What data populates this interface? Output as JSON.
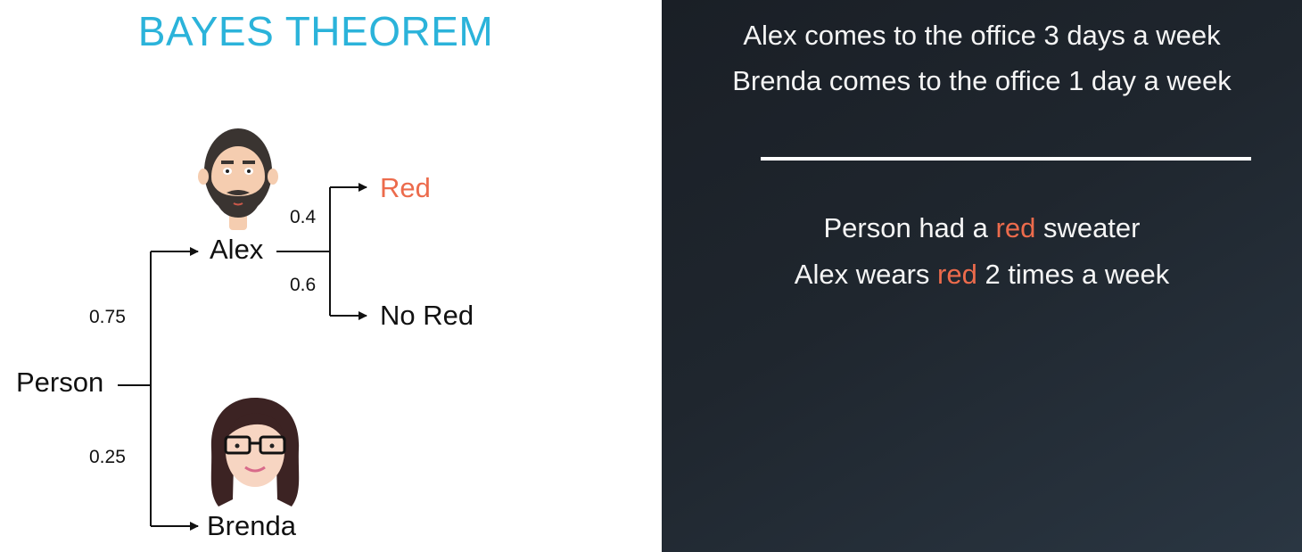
{
  "title": "BAYES THEOREM",
  "tree": {
    "root": "Person",
    "alex": "Alex",
    "brenda": "Brenda",
    "p_alex": "0.75",
    "p_brenda": "0.25",
    "red": "Red",
    "no_red": "No Red",
    "p_red": "0.4",
    "p_no_red": "0.6"
  },
  "facts": {
    "line1": "Alex comes to the office 3 days a week",
    "line2": "Brenda comes to the office 1 day a week"
  },
  "observation": {
    "line1_a": "Person had a ",
    "line1_red": "red",
    "line1_b": " sweater",
    "line2_a": "Alex wears ",
    "line2_red": "red",
    "line2_b": " 2 times a week"
  },
  "colors": {
    "title": "#2bb3da",
    "highlight": "#ec6b4c",
    "dark_panel": "#1f262e"
  }
}
